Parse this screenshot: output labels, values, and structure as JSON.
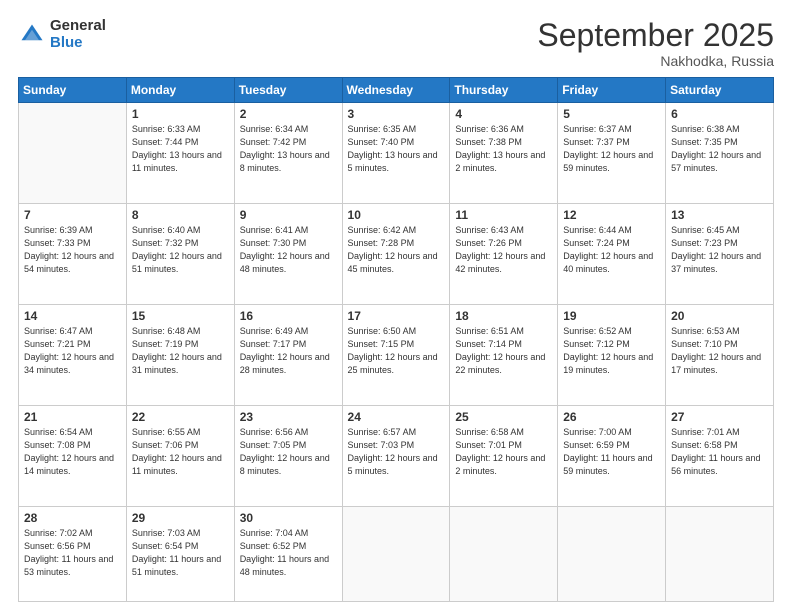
{
  "logo": {
    "general": "General",
    "blue": "Blue"
  },
  "header": {
    "month": "September 2025",
    "location": "Nakhodka, Russia"
  },
  "weekdays": [
    "Sunday",
    "Monday",
    "Tuesday",
    "Wednesday",
    "Thursday",
    "Friday",
    "Saturday"
  ],
  "weeks": [
    [
      {
        "num": "",
        "sunrise": "",
        "sunset": "",
        "daylight": ""
      },
      {
        "num": "1",
        "sunrise": "Sunrise: 6:33 AM",
        "sunset": "Sunset: 7:44 PM",
        "daylight": "Daylight: 13 hours and 11 minutes."
      },
      {
        "num": "2",
        "sunrise": "Sunrise: 6:34 AM",
        "sunset": "Sunset: 7:42 PM",
        "daylight": "Daylight: 13 hours and 8 minutes."
      },
      {
        "num": "3",
        "sunrise": "Sunrise: 6:35 AM",
        "sunset": "Sunset: 7:40 PM",
        "daylight": "Daylight: 13 hours and 5 minutes."
      },
      {
        "num": "4",
        "sunrise": "Sunrise: 6:36 AM",
        "sunset": "Sunset: 7:38 PM",
        "daylight": "Daylight: 13 hours and 2 minutes."
      },
      {
        "num": "5",
        "sunrise": "Sunrise: 6:37 AM",
        "sunset": "Sunset: 7:37 PM",
        "daylight": "Daylight: 12 hours and 59 minutes."
      },
      {
        "num": "6",
        "sunrise": "Sunrise: 6:38 AM",
        "sunset": "Sunset: 7:35 PM",
        "daylight": "Daylight: 12 hours and 57 minutes."
      }
    ],
    [
      {
        "num": "7",
        "sunrise": "Sunrise: 6:39 AM",
        "sunset": "Sunset: 7:33 PM",
        "daylight": "Daylight: 12 hours and 54 minutes."
      },
      {
        "num": "8",
        "sunrise": "Sunrise: 6:40 AM",
        "sunset": "Sunset: 7:32 PM",
        "daylight": "Daylight: 12 hours and 51 minutes."
      },
      {
        "num": "9",
        "sunrise": "Sunrise: 6:41 AM",
        "sunset": "Sunset: 7:30 PM",
        "daylight": "Daylight: 12 hours and 48 minutes."
      },
      {
        "num": "10",
        "sunrise": "Sunrise: 6:42 AM",
        "sunset": "Sunset: 7:28 PM",
        "daylight": "Daylight: 12 hours and 45 minutes."
      },
      {
        "num": "11",
        "sunrise": "Sunrise: 6:43 AM",
        "sunset": "Sunset: 7:26 PM",
        "daylight": "Daylight: 12 hours and 42 minutes."
      },
      {
        "num": "12",
        "sunrise": "Sunrise: 6:44 AM",
        "sunset": "Sunset: 7:24 PM",
        "daylight": "Daylight: 12 hours and 40 minutes."
      },
      {
        "num": "13",
        "sunrise": "Sunrise: 6:45 AM",
        "sunset": "Sunset: 7:23 PM",
        "daylight": "Daylight: 12 hours and 37 minutes."
      }
    ],
    [
      {
        "num": "14",
        "sunrise": "Sunrise: 6:47 AM",
        "sunset": "Sunset: 7:21 PM",
        "daylight": "Daylight: 12 hours and 34 minutes."
      },
      {
        "num": "15",
        "sunrise": "Sunrise: 6:48 AM",
        "sunset": "Sunset: 7:19 PM",
        "daylight": "Daylight: 12 hours and 31 minutes."
      },
      {
        "num": "16",
        "sunrise": "Sunrise: 6:49 AM",
        "sunset": "Sunset: 7:17 PM",
        "daylight": "Daylight: 12 hours and 28 minutes."
      },
      {
        "num": "17",
        "sunrise": "Sunrise: 6:50 AM",
        "sunset": "Sunset: 7:15 PM",
        "daylight": "Daylight: 12 hours and 25 minutes."
      },
      {
        "num": "18",
        "sunrise": "Sunrise: 6:51 AM",
        "sunset": "Sunset: 7:14 PM",
        "daylight": "Daylight: 12 hours and 22 minutes."
      },
      {
        "num": "19",
        "sunrise": "Sunrise: 6:52 AM",
        "sunset": "Sunset: 7:12 PM",
        "daylight": "Daylight: 12 hours and 19 minutes."
      },
      {
        "num": "20",
        "sunrise": "Sunrise: 6:53 AM",
        "sunset": "Sunset: 7:10 PM",
        "daylight": "Daylight: 12 hours and 17 minutes."
      }
    ],
    [
      {
        "num": "21",
        "sunrise": "Sunrise: 6:54 AM",
        "sunset": "Sunset: 7:08 PM",
        "daylight": "Daylight: 12 hours and 14 minutes."
      },
      {
        "num": "22",
        "sunrise": "Sunrise: 6:55 AM",
        "sunset": "Sunset: 7:06 PM",
        "daylight": "Daylight: 12 hours and 11 minutes."
      },
      {
        "num": "23",
        "sunrise": "Sunrise: 6:56 AM",
        "sunset": "Sunset: 7:05 PM",
        "daylight": "Daylight: 12 hours and 8 minutes."
      },
      {
        "num": "24",
        "sunrise": "Sunrise: 6:57 AM",
        "sunset": "Sunset: 7:03 PM",
        "daylight": "Daylight: 12 hours and 5 minutes."
      },
      {
        "num": "25",
        "sunrise": "Sunrise: 6:58 AM",
        "sunset": "Sunset: 7:01 PM",
        "daylight": "Daylight: 12 hours and 2 minutes."
      },
      {
        "num": "26",
        "sunrise": "Sunrise: 7:00 AM",
        "sunset": "Sunset: 6:59 PM",
        "daylight": "Daylight: 11 hours and 59 minutes."
      },
      {
        "num": "27",
        "sunrise": "Sunrise: 7:01 AM",
        "sunset": "Sunset: 6:58 PM",
        "daylight": "Daylight: 11 hours and 56 minutes."
      }
    ],
    [
      {
        "num": "28",
        "sunrise": "Sunrise: 7:02 AM",
        "sunset": "Sunset: 6:56 PM",
        "daylight": "Daylight: 11 hours and 53 minutes."
      },
      {
        "num": "29",
        "sunrise": "Sunrise: 7:03 AM",
        "sunset": "Sunset: 6:54 PM",
        "daylight": "Daylight: 11 hours and 51 minutes."
      },
      {
        "num": "30",
        "sunrise": "Sunrise: 7:04 AM",
        "sunset": "Sunset: 6:52 PM",
        "daylight": "Daylight: 11 hours and 48 minutes."
      },
      {
        "num": "",
        "sunrise": "",
        "sunset": "",
        "daylight": ""
      },
      {
        "num": "",
        "sunrise": "",
        "sunset": "",
        "daylight": ""
      },
      {
        "num": "",
        "sunrise": "",
        "sunset": "",
        "daylight": ""
      },
      {
        "num": "",
        "sunrise": "",
        "sunset": "",
        "daylight": ""
      }
    ]
  ]
}
